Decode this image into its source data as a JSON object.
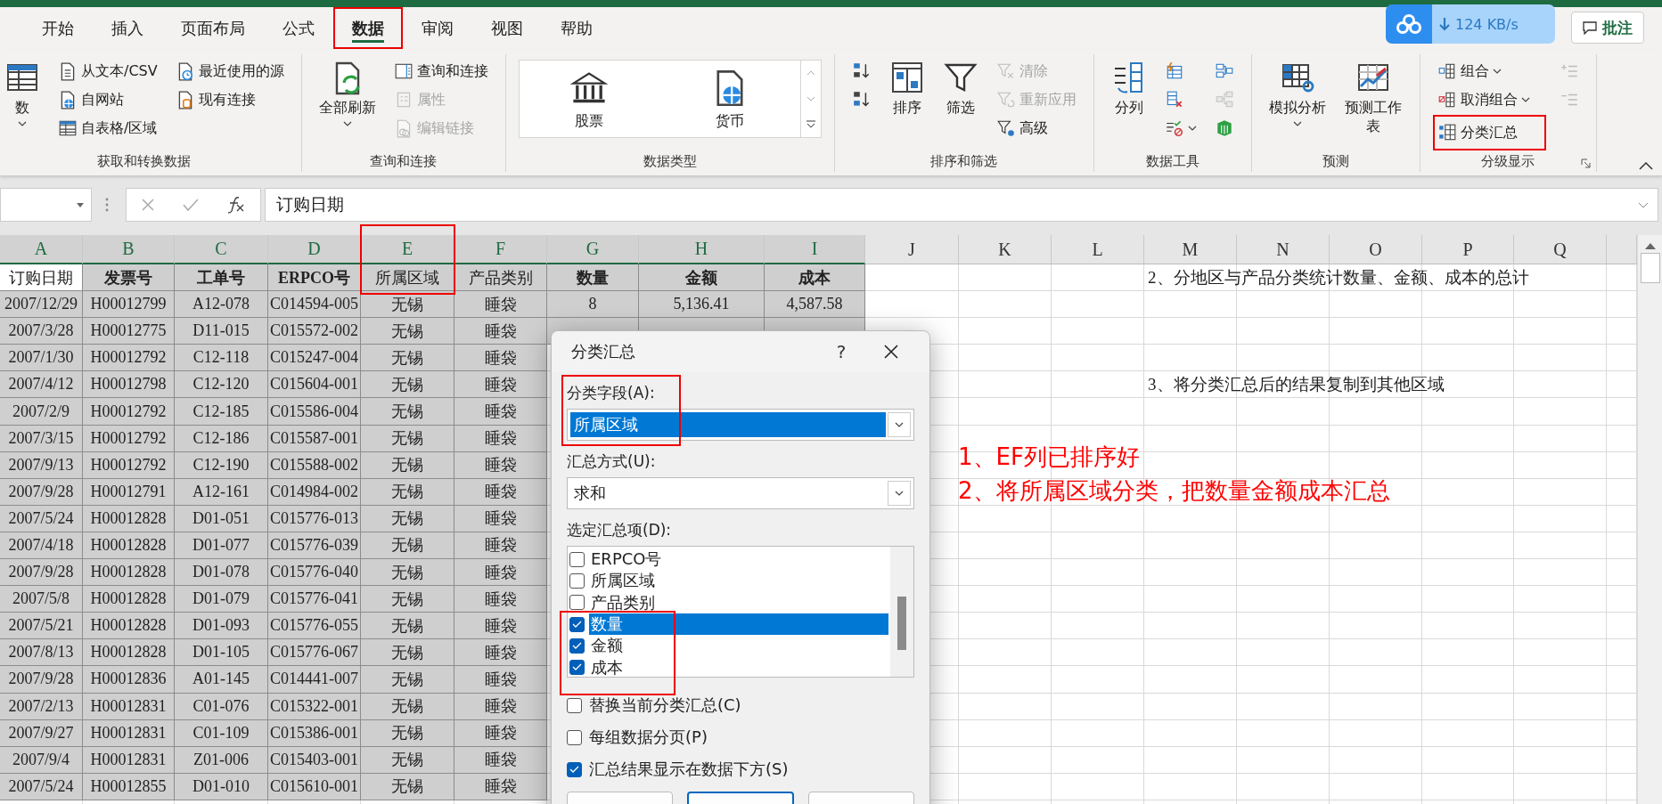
{
  "tabs": [
    {
      "label": "开始",
      "selected": false,
      "highlighted": false
    },
    {
      "label": "插入",
      "selected": false,
      "highlighted": false
    },
    {
      "label": "页面布局",
      "selected": false,
      "highlighted": false
    },
    {
      "label": "公式",
      "selected": false,
      "highlighted": false
    },
    {
      "label": "数据",
      "selected": true,
      "highlighted": true
    },
    {
      "label": "审阅",
      "selected": false,
      "highlighted": false
    },
    {
      "label": "视图",
      "selected": false,
      "highlighted": false
    },
    {
      "label": "帮助",
      "selected": false,
      "highlighted": false
    }
  ],
  "speed_badge": {
    "text": "124 KB/s"
  },
  "comment_button": {
    "label": "批注"
  },
  "ribbon": {
    "groups": [
      {
        "label": "获取和转换数据",
        "items": [
          {
            "kind": "large",
            "label": "数",
            "dropdown": true,
            "disabled": false
          },
          {
            "kind": "small",
            "label": "从文本/CSV",
            "disabled": false
          },
          {
            "kind": "small",
            "label": "自网站",
            "disabled": false
          },
          {
            "kind": "small",
            "label": "自表格/区域",
            "disabled": false
          },
          {
            "kind": "small",
            "label": "最近使用的源",
            "disabled": false
          },
          {
            "kind": "small",
            "label": "现有连接",
            "disabled": false
          }
        ]
      },
      {
        "label": "查询和连接",
        "items": [
          {
            "kind": "large",
            "label": "全部刷新",
            "dropdown": true,
            "disabled": false
          },
          {
            "kind": "small",
            "label": "查询和连接",
            "disabled": false
          },
          {
            "kind": "small",
            "label": "属性",
            "disabled": true
          },
          {
            "kind": "small",
            "label": "编辑链接",
            "disabled": true
          }
        ]
      },
      {
        "label": "数据类型",
        "items": [
          {
            "kind": "gallery",
            "options": [
              "股票",
              "货币"
            ]
          }
        ]
      },
      {
        "label": "排序和筛选",
        "items": [
          {
            "kind": "icon",
            "disabled": false
          },
          {
            "kind": "icon",
            "disabled": false
          },
          {
            "kind": "large",
            "label": "排序",
            "disabled": false
          },
          {
            "kind": "large",
            "label": "筛选",
            "disabled": false
          },
          {
            "kind": "small",
            "label": "清除",
            "disabled": true
          },
          {
            "kind": "small",
            "label": "重新应用",
            "disabled": true
          },
          {
            "kind": "small",
            "label": "高级",
            "disabled": false
          }
        ]
      },
      {
        "label": "数据工具",
        "items": [
          {
            "kind": "large",
            "label": "分列",
            "disabled": false
          },
          {
            "kind": "icon",
            "disabled": false
          },
          {
            "kind": "icon",
            "disabled": false
          },
          {
            "kind": "icon",
            "dropdown": true,
            "disabled": false
          },
          {
            "kind": "icon",
            "disabled": false
          },
          {
            "kind": "icon",
            "disabled": true
          },
          {
            "kind": "icon",
            "disabled": false
          }
        ]
      },
      {
        "label": "预测",
        "items": [
          {
            "kind": "large",
            "label": "模拟分析",
            "dropdown": true,
            "disabled": false
          },
          {
            "kind": "large",
            "label": "预测工作表",
            "disabled": false
          }
        ]
      },
      {
        "label": "分级显示",
        "launcher": true,
        "items": [
          {
            "kind": "small",
            "label": "组合",
            "dropdown": true,
            "disabled": false
          },
          {
            "kind": "small",
            "label": "取消组合",
            "dropdown": true,
            "disabled": false
          },
          {
            "kind": "small",
            "label": "分类汇总",
            "highlighted": true,
            "disabled": false
          },
          {
            "kind": "icon",
            "disabled": true
          },
          {
            "kind": "icon",
            "disabled": true
          }
        ]
      }
    ]
  },
  "formula_bar": {
    "value": "订购日期"
  },
  "sheet": {
    "columns": [
      {
        "label": "A",
        "selected": true,
        "highlighted": false
      },
      {
        "label": "B",
        "selected": true,
        "highlighted": false
      },
      {
        "label": "C",
        "selected": true,
        "highlighted": false
      },
      {
        "label": "D",
        "selected": true,
        "highlighted": false
      },
      {
        "label": "E",
        "selected": true,
        "highlighted": true
      },
      {
        "label": "F",
        "selected": true,
        "highlighted": false
      },
      {
        "label": "G",
        "selected": true,
        "highlighted": false
      },
      {
        "label": "H",
        "selected": true,
        "highlighted": false
      },
      {
        "label": "I",
        "selected": true,
        "highlighted": false
      },
      {
        "label": "J",
        "selected": false,
        "highlighted": false
      },
      {
        "label": "K",
        "selected": false,
        "highlighted": false
      },
      {
        "label": "L",
        "selected": false,
        "highlighted": false
      },
      {
        "label": "M",
        "selected": false,
        "highlighted": false
      },
      {
        "label": "N",
        "selected": false,
        "highlighted": false
      },
      {
        "label": "O",
        "selected": false,
        "highlighted": false
      },
      {
        "label": "P",
        "selected": false,
        "highlighted": false
      },
      {
        "label": "Q",
        "selected": false,
        "highlighted": false
      }
    ],
    "header_row": {
      "cells": [
        {
          "text": "订购日期",
          "bold": false,
          "active": true
        },
        {
          "text": "发票号",
          "bold": true,
          "active": false
        },
        {
          "text": "工单号",
          "bold": true,
          "active": false
        },
        {
          "text": "ERPCO号",
          "bold": true,
          "active": false
        },
        {
          "text": "所属区域",
          "bold": false,
          "active": false
        },
        {
          "text": "产品类别",
          "bold": false,
          "active": false
        },
        {
          "text": "数量",
          "bold": true,
          "active": false
        },
        {
          "text": "金额",
          "bold": true,
          "active": false
        },
        {
          "text": "成本",
          "bold": true,
          "active": false
        }
      ],
      "note": "2、分地区与产品分类统计数量、金额、成本的总计"
    },
    "rows": [
      {
        "cells": [
          "2007/12/29",
          "H00012799",
          "A12-078",
          "C014594-005",
          "无锡",
          "睡袋",
          "8",
          "5,136.41",
          "4,587.58"
        ]
      },
      {
        "cells": [
          "2007/3/28",
          "H00012775",
          "D11-015",
          "C015572-002",
          "无锡",
          "睡袋"
        ]
      },
      {
        "cells": [
          "2007/1/30",
          "H00012792",
          "C12-118",
          "C015247-004",
          "无锡",
          "睡袋"
        ]
      },
      {
        "cells": [
          "2007/4/12",
          "H00012798",
          "C12-120",
          "C015604-001",
          "无锡",
          "睡袋"
        ],
        "note": "3、将分类汇总后的结果复制到其他区域"
      },
      {
        "cells": [
          "2007/2/9",
          "H00012792",
          "C12-185",
          "C015586-004",
          "无锡",
          "睡袋"
        ]
      },
      {
        "cells": [
          "2007/3/15",
          "H00012792",
          "C12-186",
          "C015587-001",
          "无锡",
          "睡袋"
        ]
      },
      {
        "cells": [
          "2007/9/13",
          "H00012792",
          "C12-190",
          "C015588-002",
          "无锡",
          "睡袋"
        ]
      },
      {
        "cells": [
          "2007/9/28",
          "H00012791",
          "A12-161",
          "C014984-002",
          "无锡",
          "睡袋"
        ]
      },
      {
        "cells": [
          "2007/5/24",
          "H00012828",
          "D01-051",
          "C015776-013",
          "无锡",
          "睡袋"
        ]
      },
      {
        "cells": [
          "2007/4/18",
          "H00012828",
          "D01-077",
          "C015776-039",
          "无锡",
          "睡袋"
        ]
      },
      {
        "cells": [
          "2007/9/28",
          "H00012828",
          "D01-078",
          "C015776-040",
          "无锡",
          "睡袋"
        ]
      },
      {
        "cells": [
          "2007/5/8",
          "H00012828",
          "D01-079",
          "C015776-041",
          "无锡",
          "睡袋"
        ]
      },
      {
        "cells": [
          "2007/5/21",
          "H00012828",
          "D01-093",
          "C015776-055",
          "无锡",
          "睡袋"
        ]
      },
      {
        "cells": [
          "2007/8/13",
          "H00012828",
          "D01-105",
          "C015776-067",
          "无锡",
          "睡袋"
        ]
      },
      {
        "cells": [
          "2007/9/28",
          "H00012836",
          "A01-145",
          "C014441-007",
          "无锡",
          "睡袋"
        ]
      },
      {
        "cells": [
          "2007/2/13",
          "H00012831",
          "C01-076",
          "C015322-001",
          "无锡",
          "睡袋"
        ]
      },
      {
        "cells": [
          "2007/9/27",
          "H00012831",
          "C01-109",
          "C015386-001",
          "无锡",
          "睡袋"
        ]
      },
      {
        "cells": [
          "2007/9/4",
          "H00012831",
          "Z01-006",
          "C015403-001",
          "无锡",
          "睡袋"
        ]
      },
      {
        "cells": [
          "2007/5/24",
          "H00012855",
          "D01-010",
          "C015610-001",
          "无锡",
          "睡袋"
        ]
      }
    ],
    "annotations": [
      "1、EF列已排序好",
      "2、将所属区域分类，把数量金额成本汇总"
    ]
  },
  "dialog": {
    "title": "分类汇总",
    "help": "?",
    "field": {
      "label": "分类字段(A):",
      "value": "所属区域",
      "highlighted": true
    },
    "function": {
      "label": "汇总方式(U):",
      "value": "求和"
    },
    "items_label": "选定汇总项(D):",
    "items": [
      {
        "label": "ERPCO号",
        "checked": false,
        "selected": false,
        "highlighted": false
      },
      {
        "label": "所属区域",
        "checked": false,
        "selected": false,
        "highlighted": false
      },
      {
        "label": "产品类别",
        "checked": false,
        "selected": false,
        "highlighted": false
      },
      {
        "label": "数量",
        "checked": true,
        "selected": true,
        "highlighted": true
      },
      {
        "label": "金额",
        "checked": true,
        "selected": false,
        "highlighted": true
      },
      {
        "label": "成本",
        "checked": true,
        "selected": false,
        "highlighted": true
      }
    ],
    "options": [
      {
        "label": "替换当前分类汇总(C)",
        "checked": false
      },
      {
        "label": "每组数据分页(P)",
        "checked": false
      },
      {
        "label": "汇总结果显示在数据下方(S)",
        "checked": true
      }
    ],
    "buttons": [
      {
        "default": false
      },
      {
        "default": true
      },
      {
        "default": false
      }
    ]
  }
}
